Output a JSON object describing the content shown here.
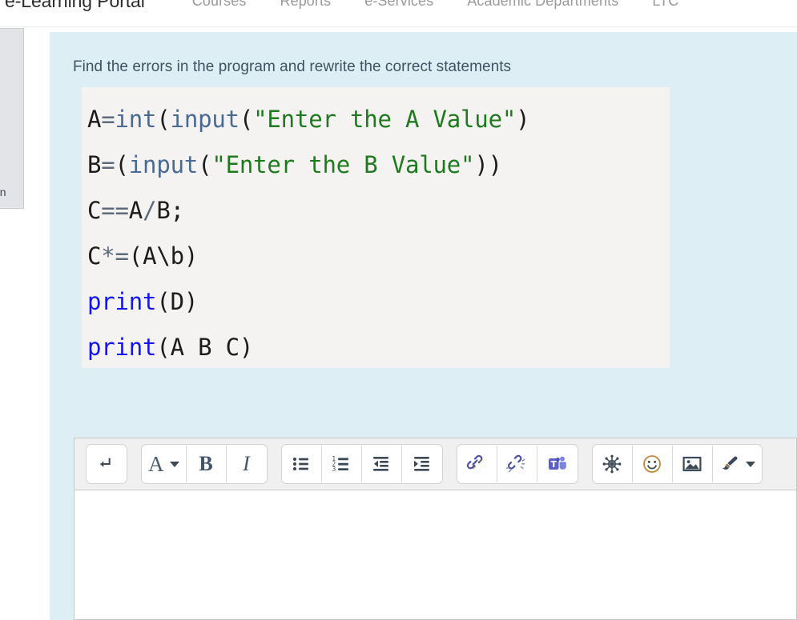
{
  "topnav": {
    "brand": "e-Learning Portal",
    "links": [
      {
        "label": "Courses"
      },
      {
        "label": "Reports"
      },
      {
        "label": "e-Services"
      },
      {
        "label": "Academic Departments"
      },
      {
        "label": "LTC"
      }
    ]
  },
  "side_panel": {
    "truncated_text": "on"
  },
  "content": {
    "question": "Find the errors in the program and rewrite the correct statements",
    "code_lines": [
      {
        "text": "A=int(input(\"Enter the A Value\")",
        "tokens": [
          {
            "t": "A",
            "c": "plain"
          },
          {
            "t": "=",
            "c": "op"
          },
          {
            "t": "int",
            "c": "builtin"
          },
          {
            "t": "(",
            "c": "paren"
          },
          {
            "t": "input",
            "c": "builtin"
          },
          {
            "t": "(",
            "c": "paren"
          },
          {
            "t": "\"Enter the A Value\"",
            "c": "string"
          },
          {
            "t": ")",
            "c": "paren"
          }
        ]
      },
      {
        "text": "B=(input(\"Enter the B Value\"))",
        "tokens": [
          {
            "t": "B",
            "c": "plain"
          },
          {
            "t": "=",
            "c": "op"
          },
          {
            "t": "(",
            "c": "paren"
          },
          {
            "t": "input",
            "c": "builtin"
          },
          {
            "t": "(",
            "c": "paren"
          },
          {
            "t": "\"Enter the B Value\"",
            "c": "string"
          },
          {
            "t": "))",
            "c": "paren"
          }
        ]
      },
      {
        "text": "C==A/B;",
        "tokens": [
          {
            "t": "C",
            "c": "plain"
          },
          {
            "t": "==",
            "c": "op"
          },
          {
            "t": "A",
            "c": "plain"
          },
          {
            "t": "/",
            "c": "op"
          },
          {
            "t": "B",
            "c": "plain"
          },
          {
            "t": ";",
            "c": "plain"
          }
        ]
      },
      {
        "text": "C*=(A\\b)",
        "tokens": [
          {
            "t": "C",
            "c": "plain"
          },
          {
            "t": "*=",
            "c": "op"
          },
          {
            "t": "(",
            "c": "paren"
          },
          {
            "t": "A",
            "c": "plain"
          },
          {
            "t": "\\",
            "c": "plain"
          },
          {
            "t": "b",
            "c": "plain"
          },
          {
            "t": ")",
            "c": "paren"
          }
        ]
      },
      {
        "text": "print(D)",
        "tokens": [
          {
            "t": "print",
            "c": "print"
          },
          {
            "t": "(",
            "c": "paren"
          },
          {
            "t": "D",
            "c": "plain"
          },
          {
            "t": ")",
            "c": "paren"
          }
        ]
      },
      {
        "text": "print(A B C)",
        "tokens": [
          {
            "t": "print",
            "c": "print"
          },
          {
            "t": "(",
            "c": "paren"
          },
          {
            "t": "A B C",
            "c": "plain"
          },
          {
            "t": ")",
            "c": "paren"
          }
        ]
      }
    ]
  },
  "editor": {
    "body_value": "",
    "toolbar_groups": [
      {
        "name": "linebreak-group",
        "buttons": [
          {
            "name": "insert-line-break-button",
            "icon": "line-break-icon",
            "label": ""
          }
        ]
      },
      {
        "name": "text-format-group",
        "buttons": [
          {
            "name": "font-family-button",
            "icon": "font-a-icon",
            "label": "A",
            "has_caret": true
          },
          {
            "name": "bold-button",
            "icon": "bold-icon",
            "label": "B"
          },
          {
            "name": "italic-button",
            "icon": "italic-icon",
            "label": "I"
          }
        ]
      },
      {
        "name": "list-indent-group",
        "buttons": [
          {
            "name": "bulleted-list-button",
            "icon": "bulleted-list-icon",
            "label": ""
          },
          {
            "name": "numbered-list-button",
            "icon": "numbered-list-icon",
            "label": ""
          },
          {
            "name": "decrease-indent-button",
            "icon": "decrease-indent-icon",
            "label": ""
          },
          {
            "name": "increase-indent-button",
            "icon": "increase-indent-icon",
            "label": ""
          }
        ]
      },
      {
        "name": "link-group",
        "buttons": [
          {
            "name": "insert-link-button",
            "icon": "link-icon",
            "label": ""
          },
          {
            "name": "remove-link-button",
            "icon": "unlink-icon",
            "label": ""
          },
          {
            "name": "microsoft-teams-button",
            "icon": "microsoft-teams-icon",
            "label": ""
          }
        ]
      },
      {
        "name": "insert-group",
        "buttons": [
          {
            "name": "special-character-button",
            "icon": "special-character-icon",
            "label": ""
          },
          {
            "name": "emoji-button",
            "icon": "smiley-icon",
            "label": ""
          },
          {
            "name": "insert-image-button",
            "icon": "image-icon",
            "label": ""
          },
          {
            "name": "text-highlight-button",
            "icon": "paint-brush-icon",
            "label": "",
            "has_caret": true
          }
        ]
      }
    ]
  },
  "colors": {
    "panel_background": "#ddeff5",
    "code_background": "#f5f3f1",
    "toolbar_background": "#f0f0f0",
    "question_text": "#3f5260",
    "string_token": "#1f7a1f",
    "print_token": "#1414f0",
    "builtin_token": "#4a6a96",
    "side_panel": "#e2e4e7",
    "teams_purple": "#5b5fc7"
  }
}
